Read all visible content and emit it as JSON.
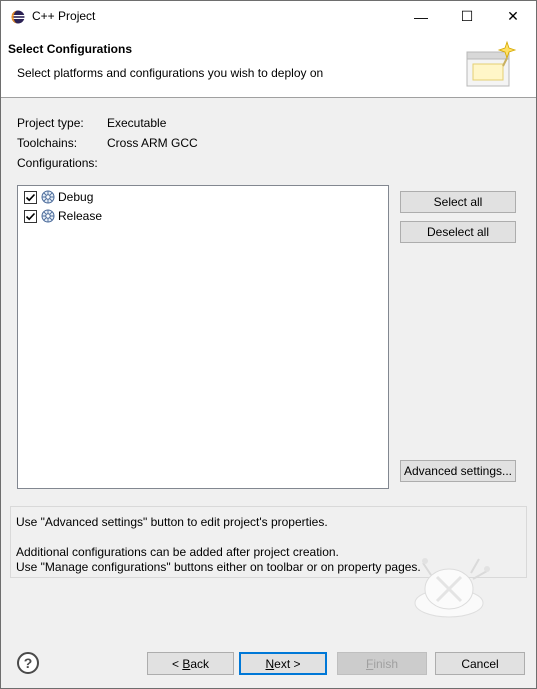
{
  "window": {
    "title": "C++ Project",
    "minimize": "—",
    "maximize": "☐",
    "close": "✕"
  },
  "banner": {
    "title": "Select Configurations",
    "description": "Select platforms and configurations you wish to deploy on"
  },
  "info": {
    "project_type_label": "Project type:",
    "project_type_value": "Executable",
    "toolchains_label": "Toolchains:",
    "toolchains_value": "Cross ARM GCC",
    "configurations_label": "Configurations:"
  },
  "configurations": [
    {
      "name": "Debug",
      "checked": true
    },
    {
      "name": "Release",
      "checked": true
    }
  ],
  "buttons": {
    "select_all": "Select all",
    "deselect_all": "Deselect all",
    "advanced_settings": "Advanced settings...",
    "back_prefix": "< ",
    "back_mnemonic": "B",
    "back_rest": "ack",
    "next_mnemonic": "N",
    "next_rest": "ext >",
    "finish_mnemonic": "F",
    "finish_rest": "inish",
    "cancel": "Cancel"
  },
  "help": {
    "line1": "Use \"Advanced settings\" button to edit project's properties.",
    "line2": "Additional configurations can be added after project creation.",
    "line3": "Use \"Manage configurations\" buttons either on toolbar or on property pages.",
    "help_glyph": "?"
  },
  "icons": {
    "app": "eclipse-icon",
    "banner": "wizard-banner-icon",
    "config": "configuration-icon",
    "help": "help-icon"
  },
  "colors": {
    "accent": "#0078d7",
    "window_bg": "#f0f0f0",
    "button_bg": "#e1e1e1"
  }
}
